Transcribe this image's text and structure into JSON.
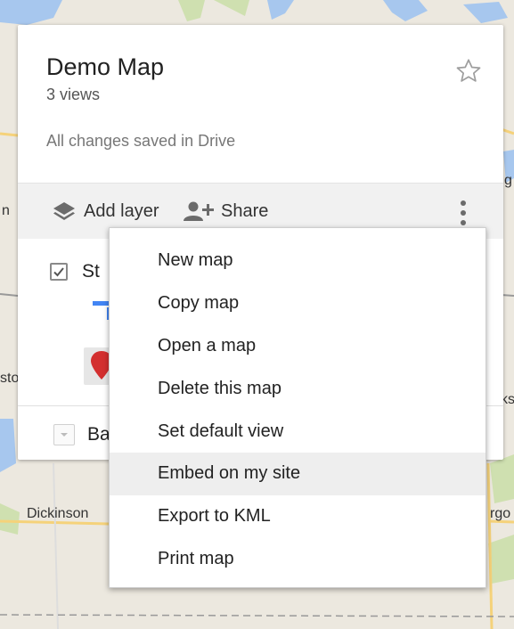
{
  "map": {
    "labels": {
      "left_edge": "n",
      "left_edge_low": "sto",
      "city": "Dickinson",
      "right_upper": "g",
      "right_mid": "ks",
      "right_lower": "rgo"
    }
  },
  "panel": {
    "title": "Demo Map",
    "views": "3 views",
    "save_status": "All changes saved in Drive",
    "star_icon": "star-outline-icon",
    "toolbar": {
      "add_layer_label": "Add layer",
      "add_layer_icon": "layers-icon",
      "share_label": "Share",
      "share_icon": "person-add-icon",
      "more_icon": "more-vertical-icon"
    },
    "layer": {
      "name": "St",
      "checked": true
    },
    "base_map": {
      "label": "Ba"
    }
  },
  "menu": {
    "highlighted_index": 5,
    "items": [
      {
        "label": "New map"
      },
      {
        "label": "Copy map"
      },
      {
        "label": "Open a map"
      },
      {
        "label": "Delete this map"
      },
      {
        "label": "Set default view"
      },
      {
        "label": "Embed on my site"
      },
      {
        "label": "Export to KML"
      },
      {
        "label": "Print map"
      }
    ]
  },
  "colors": {
    "map_land": "#ece8df",
    "water": "#a7c7ee",
    "park": "#cfe0b0",
    "road_yellow": "#f5d27a",
    "marker_red": "#d32f2f",
    "style_blue": "#4285f4",
    "menu_highlight": "#eeeeee"
  }
}
